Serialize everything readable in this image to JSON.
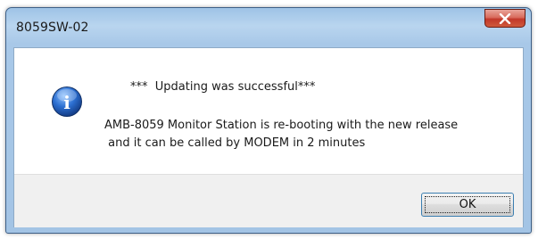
{
  "window": {
    "title": "8059SW-02"
  },
  "message": {
    "headline": "***  Updating was successful***",
    "line1": "AMB-8059 Monitor Station is re-booting with the new release",
    "line2": " and it can be called by MODEM in 2 minutes"
  },
  "buttons": {
    "ok_label": "OK",
    "close_icon": "close-x"
  },
  "icon": {
    "type": "information-icon",
    "glyph": "i"
  },
  "colors": {
    "title_bar": "#a8c8e8",
    "close_button": "#c2382a",
    "info_icon": "#1f5fb5",
    "footer": "#f0f0f0",
    "button_border": "#3c7fb1"
  }
}
